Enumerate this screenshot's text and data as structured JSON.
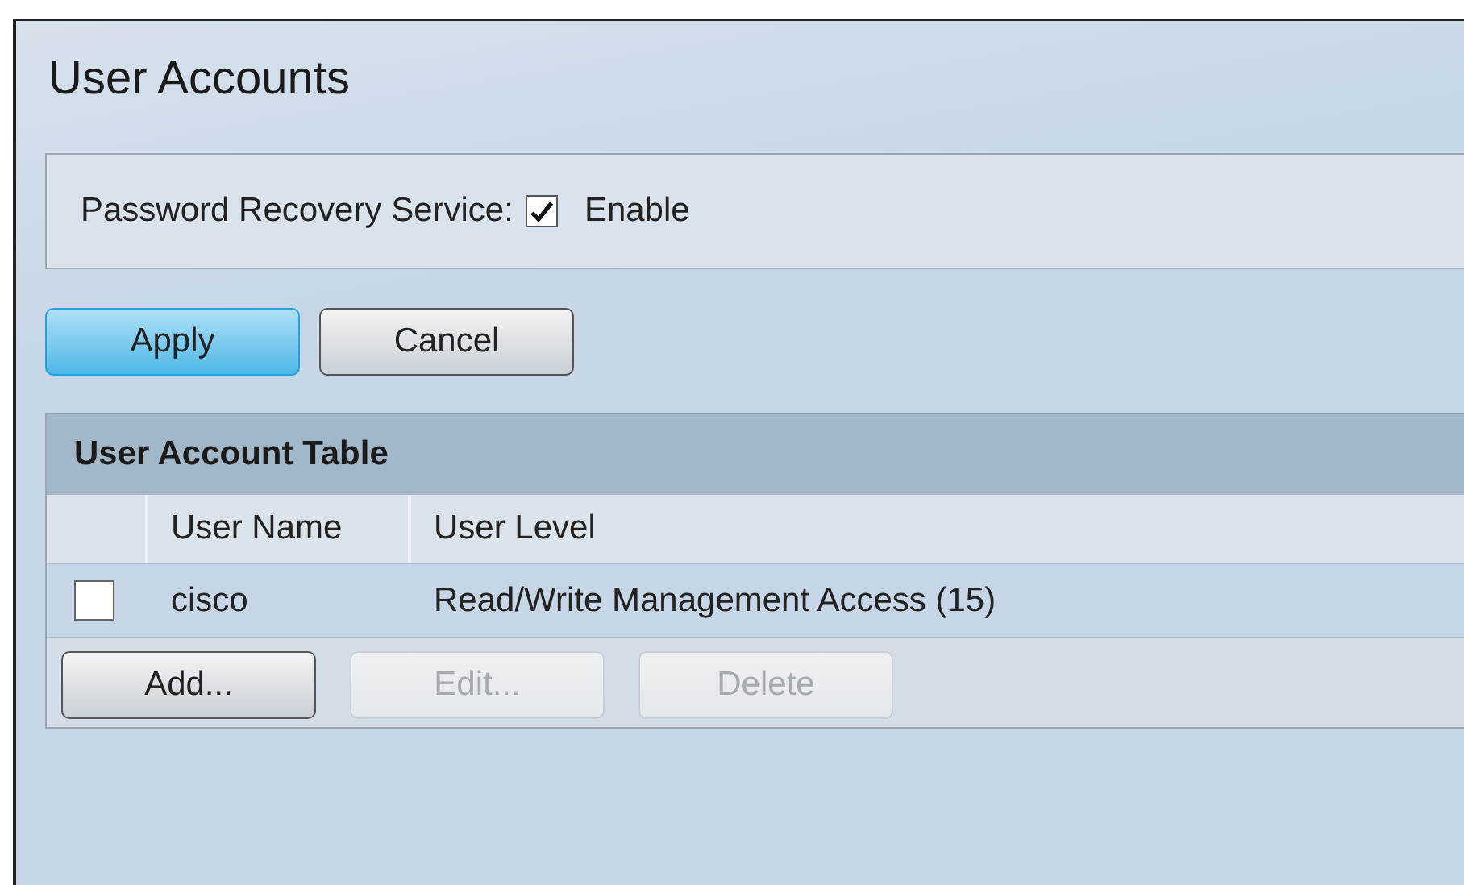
{
  "page": {
    "title": "User Accounts"
  },
  "password_recovery": {
    "label": "Password Recovery Service:",
    "checked": true,
    "option_label": "Enable"
  },
  "form_buttons": [
    {
      "label": "Apply",
      "kind": "primary"
    },
    {
      "label": "Cancel",
      "kind": "normal"
    }
  ],
  "table": {
    "title": "User Account Table",
    "columns": [
      "User Name",
      "User Level"
    ],
    "rows": [
      {
        "checked": false,
        "cells": [
          "cisco",
          "Read/Write Management Access (15)"
        ]
      }
    ],
    "buttons": [
      {
        "label": "Add...",
        "disabled": false
      },
      {
        "label": "Edit...",
        "disabled": true
      },
      {
        "label": "Delete",
        "disabled": true
      }
    ]
  }
}
